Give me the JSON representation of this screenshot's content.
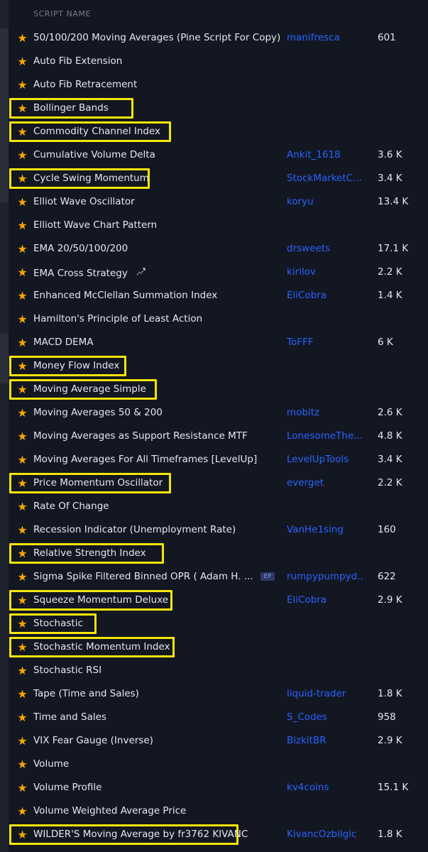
{
  "header": {
    "col_name": "SCRIPT NAME"
  },
  "rows": [
    {
      "name": "50/100/200 Moving Averages (Pine Script For Copy)",
      "author": "manifresca",
      "likes": "601"
    },
    {
      "name": "Auto Fib Extension",
      "author": "",
      "likes": ""
    },
    {
      "name": "Auto Fib Retracement",
      "author": "",
      "likes": ""
    },
    {
      "name": "Bollinger Bands",
      "author": "",
      "likes": "",
      "highlighted": true
    },
    {
      "name": "Commodity Channel Index",
      "author": "",
      "likes": "",
      "highlighted": true
    },
    {
      "name": "Cumulative Volume Delta",
      "author": "Ankit_1618",
      "likes": "3.6 K"
    },
    {
      "name": "Cycle Swing Momentum",
      "author": "StockMarketC...",
      "likes": "3.4 K",
      "highlighted": true
    },
    {
      "name": "Elliot Wave Oscillator",
      "author": "koryu",
      "likes": "13.4 K"
    },
    {
      "name": "Elliott Wave Chart Pattern",
      "author": "",
      "likes": ""
    },
    {
      "name": "EMA 20/50/100/200",
      "author": "drsweets",
      "likes": "17.1 K"
    },
    {
      "name": "EMA Cross Strategy",
      "author": "kirilov",
      "likes": "2.2 K",
      "icon": "strategy-icon"
    },
    {
      "name": "Enhanced McClellan Summation Index",
      "author": "EliCobra",
      "likes": "1.4 K"
    },
    {
      "name": "Hamilton's Principle of Least Action",
      "author": "",
      "likes": ""
    },
    {
      "name": "MACD DEMA",
      "author": "ToFFF",
      "likes": "6 K"
    },
    {
      "name": "Money Flow Index",
      "author": "",
      "likes": "",
      "highlighted": true
    },
    {
      "name": "Moving Average Simple",
      "author": "",
      "likes": "",
      "highlighted": true
    },
    {
      "name": "Moving Averages 50 & 200",
      "author": "mobitz",
      "likes": "2.6 K"
    },
    {
      "name": "Moving Averages as Support Resistance MTF",
      "author": "LonesomeThe...",
      "likes": "4.8 K"
    },
    {
      "name": "Moving Averages For All Timeframes [LevelUp]",
      "author": "LevelUpTools",
      "likes": "3.4 K"
    },
    {
      "name": "Price Momentum Oscillator",
      "author": "everget",
      "likes": "2.2 K",
      "highlighted": true
    },
    {
      "name": "Rate Of Change",
      "author": "",
      "likes": ""
    },
    {
      "name": "Recession Indicator (Unemployment Rate)",
      "author": "VanHe1sing",
      "likes": "160"
    },
    {
      "name": "Relative Strength Index",
      "author": "",
      "likes": "",
      "highlighted": true
    },
    {
      "name": "Sigma Spike Filtered Binned OPR ( Adam H. ...",
      "author": "rumpypumpyd...",
      "likes": "622",
      "badge": "EP"
    },
    {
      "name": "Squeeze Momentum Deluxe",
      "author": "EliCobra",
      "likes": "2.9 K",
      "highlighted": true
    },
    {
      "name": "Stochastic",
      "author": "",
      "likes": "",
      "highlighted": true
    },
    {
      "name": "Stochastic Momentum Index",
      "author": "",
      "likes": "",
      "highlighted": true
    },
    {
      "name": "Stochastic RSI",
      "author": "",
      "likes": ""
    },
    {
      "name": "Tape (Time and Sales)",
      "author": "liquid-trader",
      "likes": "1.8 K"
    },
    {
      "name": "Time and Sales",
      "author": "S_Codes",
      "likes": "958"
    },
    {
      "name": "VIX Fear Gauge (Inverse)",
      "author": "BizkitBR",
      "likes": "2.9 K"
    },
    {
      "name": "Volume",
      "author": "",
      "likes": ""
    },
    {
      "name": "Volume Profile",
      "author": "kv4coins",
      "likes": "15.1 K"
    },
    {
      "name": "Volume Weighted Average Price",
      "author": "",
      "likes": ""
    },
    {
      "name": "WILDER'S Moving Average by fr3762 KIVANC",
      "author": "KivancOzbilgic",
      "likes": "1.8 K",
      "highlighted": true
    }
  ],
  "colors": {
    "star": "#f7a600",
    "author_link": "#2962ff",
    "highlight": "#f5e50a"
  }
}
